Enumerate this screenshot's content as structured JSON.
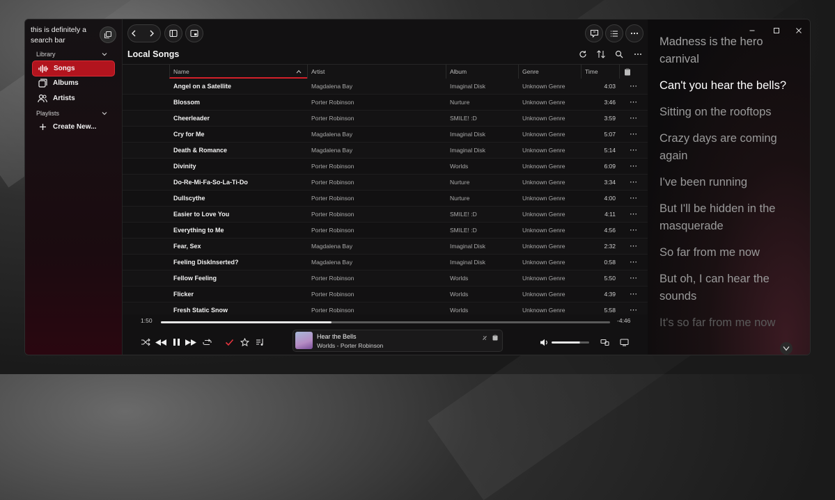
{
  "sidebar": {
    "search_text": "this is definitely a search bar",
    "library_label": "Library",
    "playlists_label": "Playlists",
    "items": [
      {
        "label": "Songs",
        "icon": "waveform-icon"
      },
      {
        "label": "Albums",
        "icon": "album-icon"
      },
      {
        "label": "Artists",
        "icon": "artists-icon"
      }
    ],
    "create_new_label": "Create New...",
    "accent": "#b2141e"
  },
  "header": {
    "title": "Local Songs"
  },
  "table": {
    "columns": [
      "Name",
      "Artist",
      "Album",
      "Genre",
      "Time"
    ],
    "rows": [
      {
        "name": "Angel on a Satellite",
        "artist": "Magdalena Bay",
        "album": "Imaginal Disk",
        "genre": "Unknown Genre",
        "time": "4:03"
      },
      {
        "name": "Blossom",
        "artist": "Porter Robinson",
        "album": "Nurture",
        "genre": "Unknown Genre",
        "time": "3:46"
      },
      {
        "name": "Cheerleader",
        "artist": "Porter Robinson",
        "album": "SMILE! :D",
        "genre": "Unknown Genre",
        "time": "3:59"
      },
      {
        "name": "Cry for Me",
        "artist": "Magdalena Bay",
        "album": "Imaginal Disk",
        "genre": "Unknown Genre",
        "time": "5:07"
      },
      {
        "name": "Death & Romance",
        "artist": "Magdalena Bay",
        "album": "Imaginal Disk",
        "genre": "Unknown Genre",
        "time": "5:14"
      },
      {
        "name": "Divinity",
        "artist": "Porter Robinson",
        "album": "Worlds",
        "genre": "Unknown Genre",
        "time": "6:09"
      },
      {
        "name": "Do-Re-Mi-Fa-So-La-Ti-Do",
        "artist": "Porter Robinson",
        "album": "Nurture",
        "genre": "Unknown Genre",
        "time": "3:34"
      },
      {
        "name": "Dullscythe",
        "artist": "Porter Robinson",
        "album": "Nurture",
        "genre": "Unknown Genre",
        "time": "4:00"
      },
      {
        "name": "Easier to Love You",
        "artist": "Porter Robinson",
        "album": "SMILE! :D",
        "genre": "Unknown Genre",
        "time": "4:11"
      },
      {
        "name": "Everything to Me",
        "artist": "Porter Robinson",
        "album": "SMILE! :D",
        "genre": "Unknown Genre",
        "time": "4:56"
      },
      {
        "name": "Fear, Sex",
        "artist": "Magdalena Bay",
        "album": "Imaginal Disk",
        "genre": "Unknown Genre",
        "time": "2:32"
      },
      {
        "name": "Feeling DiskInserted?",
        "artist": "Magdalena Bay",
        "album": "Imaginal Disk",
        "genre": "Unknown Genre",
        "time": "0:58"
      },
      {
        "name": "Fellow Feeling",
        "artist": "Porter Robinson",
        "album": "Worlds",
        "genre": "Unknown Genre",
        "time": "5:50"
      },
      {
        "name": "Flicker",
        "artist": "Porter Robinson",
        "album": "Worlds",
        "genre": "Unknown Genre",
        "time": "4:39"
      },
      {
        "name": "Fresh Static Snow",
        "artist": "Porter Robinson",
        "album": "Worlds",
        "genre": "Unknown Genre",
        "time": "5:58"
      }
    ]
  },
  "player": {
    "elapsed": "1:50",
    "remaining": "-4:46",
    "progress": 0.38,
    "track_title": "Hear the Bells",
    "track_subtitle": "Worlds - Porter Robinson",
    "volume": 0.75
  },
  "lyrics": {
    "lines": [
      {
        "text": "Madness is the hero carnival",
        "state": "past"
      },
      {
        "text": "Can't you hear the bells?",
        "state": "current"
      },
      {
        "text": "Sitting on the rooftops",
        "state": "upcoming"
      },
      {
        "text": "Crazy days are coming again",
        "state": "upcoming"
      },
      {
        "text": "I've been running",
        "state": "upcoming"
      },
      {
        "text": "But I'll be hidden in the masquerade",
        "state": "upcoming"
      },
      {
        "text": "So far from me now",
        "state": "upcoming"
      },
      {
        "text": "But oh, I can hear the sounds",
        "state": "upcoming"
      },
      {
        "text": "It's so far from me now",
        "state": "fading"
      }
    ]
  }
}
